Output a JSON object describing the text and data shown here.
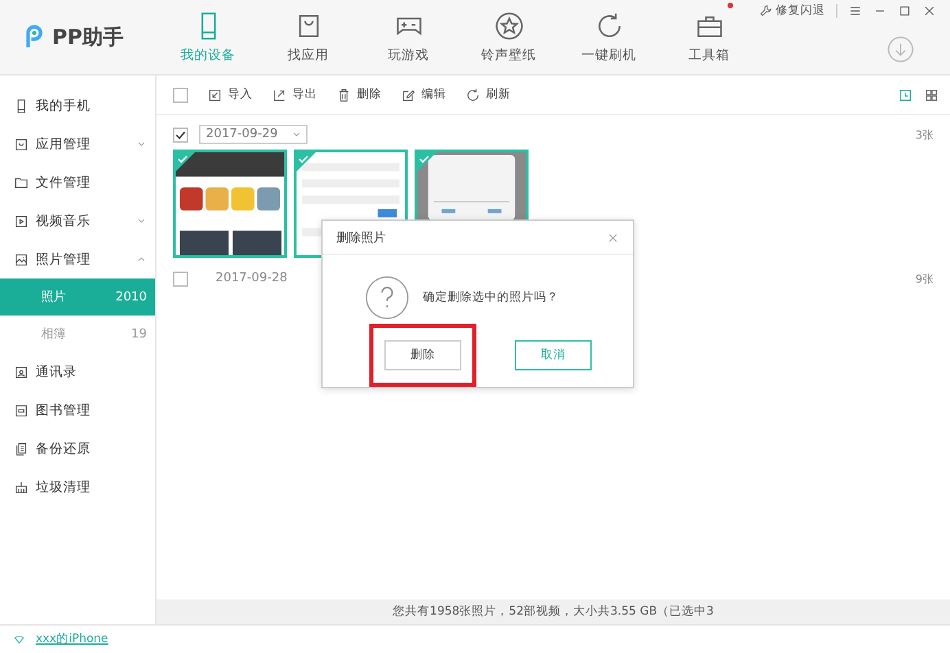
{
  "app": {
    "name": "PP助手"
  },
  "nav_tabs": [
    {
      "label": "我的设备",
      "selected": true,
      "badge": false
    },
    {
      "label": "找应用",
      "selected": false,
      "badge": false
    },
    {
      "label": "玩游戏",
      "selected": false,
      "badge": false
    },
    {
      "label": "铃声壁纸",
      "selected": false,
      "badge": false
    },
    {
      "label": "一键刷机",
      "selected": false,
      "badge": false
    },
    {
      "label": "工具箱",
      "selected": false,
      "badge": true
    }
  ],
  "window_controls": {
    "repair_label": "修复闪退"
  },
  "sidebar": {
    "items": [
      {
        "label": "我的手机",
        "kind": "link"
      },
      {
        "label": "应用管理",
        "kind": "group",
        "expanded": false
      },
      {
        "label": "文件管理",
        "kind": "link"
      },
      {
        "label": "视频音乐",
        "kind": "group",
        "expanded": false
      },
      {
        "label": "照片管理",
        "kind": "group",
        "expanded": true,
        "children": [
          {
            "label": "照片",
            "count": "2010",
            "selected": true
          },
          {
            "label": "相簿",
            "count": "19",
            "selected": false
          }
        ]
      },
      {
        "label": "通讯录",
        "kind": "link"
      },
      {
        "label": "图书管理",
        "kind": "link"
      },
      {
        "label": "备份还原",
        "kind": "link"
      },
      {
        "label": "垃圾清理",
        "kind": "link"
      }
    ]
  },
  "toolbar": {
    "select_all": {
      "checked": false
    },
    "actions": [
      {
        "label": "导入"
      },
      {
        "label": "导出"
      },
      {
        "label": "删除"
      },
      {
        "label": "编辑"
      },
      {
        "label": "刷新"
      }
    ],
    "views": [
      {
        "selected": true
      },
      {
        "selected": false
      }
    ]
  },
  "photo_groups": [
    {
      "date": "2017-09-29",
      "kind": "dropdown",
      "checked": true,
      "count": "3张",
      "photos": [
        {
          "kind": "picture",
          "selected": true
        },
        {
          "kind": "picture",
          "selected": true
        },
        {
          "kind": "picture",
          "selected": true
        }
      ]
    },
    {
      "date": "2017-09-28",
      "kind": "plain",
      "checked": false,
      "count": "9张"
    }
  ],
  "dialog": {
    "title": "删除照片",
    "message": "确定删除选中的照片吗？",
    "buttons": [
      {
        "label": "删除",
        "kind": "secondary",
        "highlighted": true
      },
      {
        "label": "取消",
        "kind": "primary",
        "highlighted": false
      }
    ]
  },
  "status_bar": {
    "text": "您共有1958张照片，52部视频，大小共3.55 GB（已选中3"
  },
  "device": {
    "name": "xxx的iPhone"
  }
}
